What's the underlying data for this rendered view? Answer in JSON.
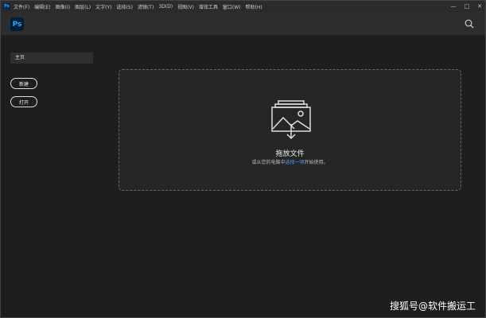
{
  "menubar": {
    "app_icon": "Ps",
    "items": [
      "文件(F)",
      "编辑(E)",
      "图像(I)",
      "图层(L)",
      "文字(Y)",
      "选择(S)",
      "滤镜(T)",
      "3D(D)",
      "视图(V)",
      "增效工具",
      "窗口(W)",
      "帮助(H)"
    ],
    "controls": [
      "—",
      "□",
      "✕"
    ]
  },
  "header": {
    "logo": "Ps",
    "search_icon": "search-icon"
  },
  "sidebar": {
    "home": "主页",
    "new": "新建",
    "open": "打开"
  },
  "drop": {
    "title": "拖放文件",
    "prefix": "或从您的电脑中",
    "link": "选择一项",
    "suffix": "开始使用。"
  },
  "watermark": "搜狐号@软件搬运工",
  "colors": {
    "accent": "#31a8ff",
    "link": "#4a9eff",
    "bg": "#1e1e1e"
  }
}
